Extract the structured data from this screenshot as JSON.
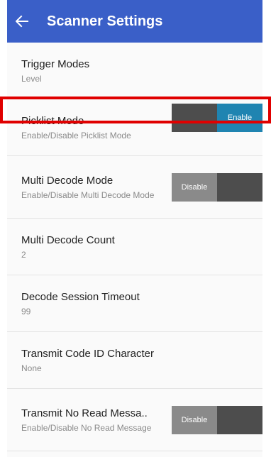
{
  "header": {
    "title": "Scanner Settings",
    "back_icon": "arrow-left-icon"
  },
  "settings": [
    {
      "title": "Trigger Modes",
      "subtitle": "Level"
    },
    {
      "title": "Picklist Mode",
      "subtitle": "Enable/Disable Picklist Mode",
      "toggle": {
        "state": "enabled",
        "label": "Enable"
      }
    },
    {
      "title": "Multi Decode Mode",
      "subtitle": "Enable/Disable Multi Decode Mode",
      "toggle": {
        "state": "disabled",
        "label": "Disable"
      }
    },
    {
      "title": "Multi Decode Count",
      "subtitle": "2"
    },
    {
      "title": "Decode Session Timeout",
      "subtitle": "99"
    },
    {
      "title": "Transmit Code ID Character",
      "subtitle": "None"
    },
    {
      "title": "Transmit No Read Messa..",
      "subtitle": "Enable/Disable No Read Message",
      "toggle": {
        "state": "disabled",
        "label": "Disable"
      }
    }
  ],
  "colors": {
    "app_bar": "#3a5fc8",
    "toggle_enabled": "#1f84b1",
    "toggle_disabled": "#8a8a8a",
    "toggle_off_segment": "#4d4d4d",
    "highlight": "#e00000"
  }
}
